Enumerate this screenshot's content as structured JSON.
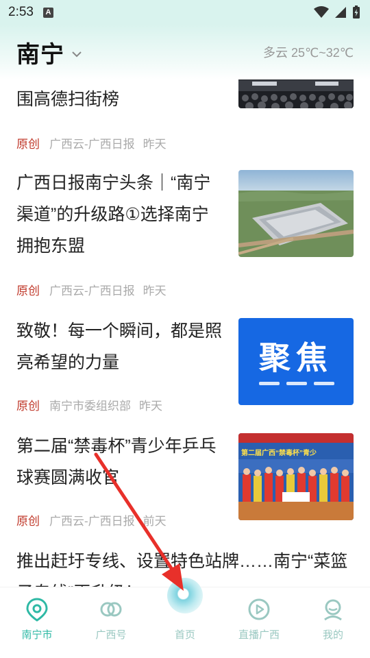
{
  "status_bar": {
    "time": "2:53",
    "notification_badge": "A"
  },
  "header": {
    "city": "南宁",
    "weather": "多云 25℃~32℃"
  },
  "feed": [
    {
      "title": "围高德扫街榜",
      "original": "原创",
      "source": "广西云-广西日报",
      "time": "昨天",
      "thumb_icon": "conference-photo"
    },
    {
      "title": "广西日报南宁头条｜“南宁渠道”的升级路①选择南宁拥抱东盟",
      "original": "原创",
      "source": "广西云-广西日报",
      "time": "昨天",
      "thumb_icon": "aerial-logistics-park-photo"
    },
    {
      "title": "致敬！每一个瞬间，都是照亮希望的力量",
      "original": "原创",
      "source": "南宁市委组织部",
      "time": "昨天",
      "thumb_icon": "focus-banner",
      "thumb_text": "聚焦"
    },
    {
      "title": "第二届“禁毒杯”青少年乒乓球赛圆满收官",
      "original": "原创",
      "source": "广西云-广西日报",
      "time": "前天",
      "thumb_icon": "table-tennis-group-photo",
      "thumb_text": "第二届广西“禁毒杯”青少"
    },
    {
      "title": "推出赶圩专线、设置特色站牌……南宁“菜篮子专线”再升级！"
    }
  ],
  "bottom_nav": [
    {
      "label": "南宁市",
      "icon": "location-pin-icon",
      "active": true
    },
    {
      "label": "广西号",
      "icon": "rings-icon",
      "active": false
    },
    {
      "label": "首页",
      "icon": "home-orb-icon",
      "active": false
    },
    {
      "label": "直播广西",
      "icon": "play-circle-icon",
      "active": false
    },
    {
      "label": "我的",
      "icon": "profile-icon",
      "active": false
    }
  ],
  "colors": {
    "accent": "#2fb9a5",
    "original_tag": "#c0392b",
    "annotation_arrow": "#e8302a"
  }
}
